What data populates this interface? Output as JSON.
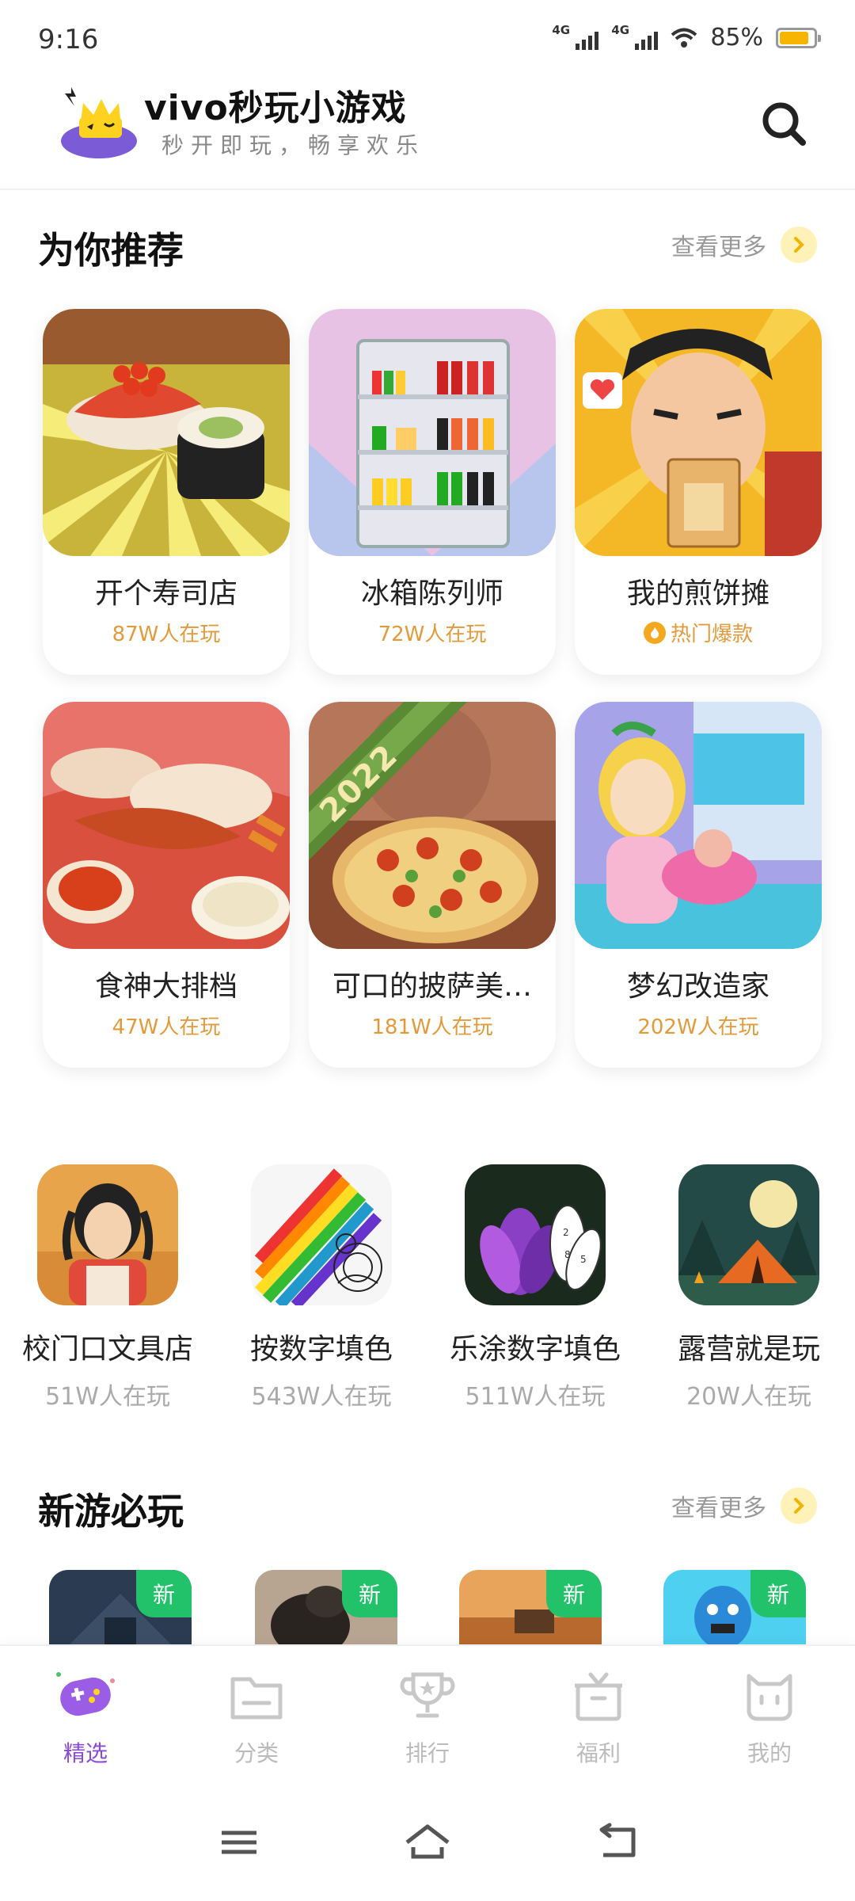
{
  "status_bar": {
    "time": "9:16",
    "signal1_label": "4G",
    "signal2_label": "4G",
    "battery_percent": "85%",
    "battery_level": 0.85
  },
  "header": {
    "app_title": "vivo秒玩小游戏",
    "app_subtitle": "秒开即玩，畅享欢乐",
    "search_icon": "search-icon"
  },
  "recommend": {
    "title": "为你推荐",
    "more_label": "查看更多",
    "games": [
      {
        "name": "开个寿司店",
        "players": "87W人在玩",
        "hot": false
      },
      {
        "name": "冰箱陈列师",
        "players": "72W人在玩",
        "hot": false
      },
      {
        "name": "我的煎饼摊",
        "players": "热门爆款",
        "hot": true
      },
      {
        "name": "食神大排档",
        "players": "47W人在玩",
        "hot": false
      },
      {
        "name": "可口的披萨美…",
        "players": "181W人在玩",
        "hot": false
      },
      {
        "name": "梦幻改造家",
        "players": "202W人在玩",
        "hot": false
      }
    ],
    "fridge_year": "2022"
  },
  "apps_row": [
    {
      "name": "校门口文具店",
      "players": "51W人在玩"
    },
    {
      "name": "按数字填色",
      "players": "543W人在玩"
    },
    {
      "name": "乐涂数字填色",
      "players": "511W人在玩"
    },
    {
      "name": "露营就是玩",
      "players": "20W人在玩"
    }
  ],
  "new_games": {
    "title": "新游必玩",
    "more_label": "查看更多",
    "badge": "新"
  },
  "bottom_nav": [
    {
      "label": "精选",
      "icon": "gamepad-icon",
      "active": true
    },
    {
      "label": "分类",
      "icon": "folder-icon",
      "active": false
    },
    {
      "label": "排行",
      "icon": "trophy-icon",
      "active": false
    },
    {
      "label": "福利",
      "icon": "gift-icon",
      "active": false
    },
    {
      "label": "我的",
      "icon": "profile-icon",
      "active": false
    }
  ],
  "colors": {
    "accent_orange": "#e39a3b",
    "nav_active": "#8a4bd8",
    "new_badge": "#22c26a",
    "more_chevron_bg": "#fff2b8"
  }
}
